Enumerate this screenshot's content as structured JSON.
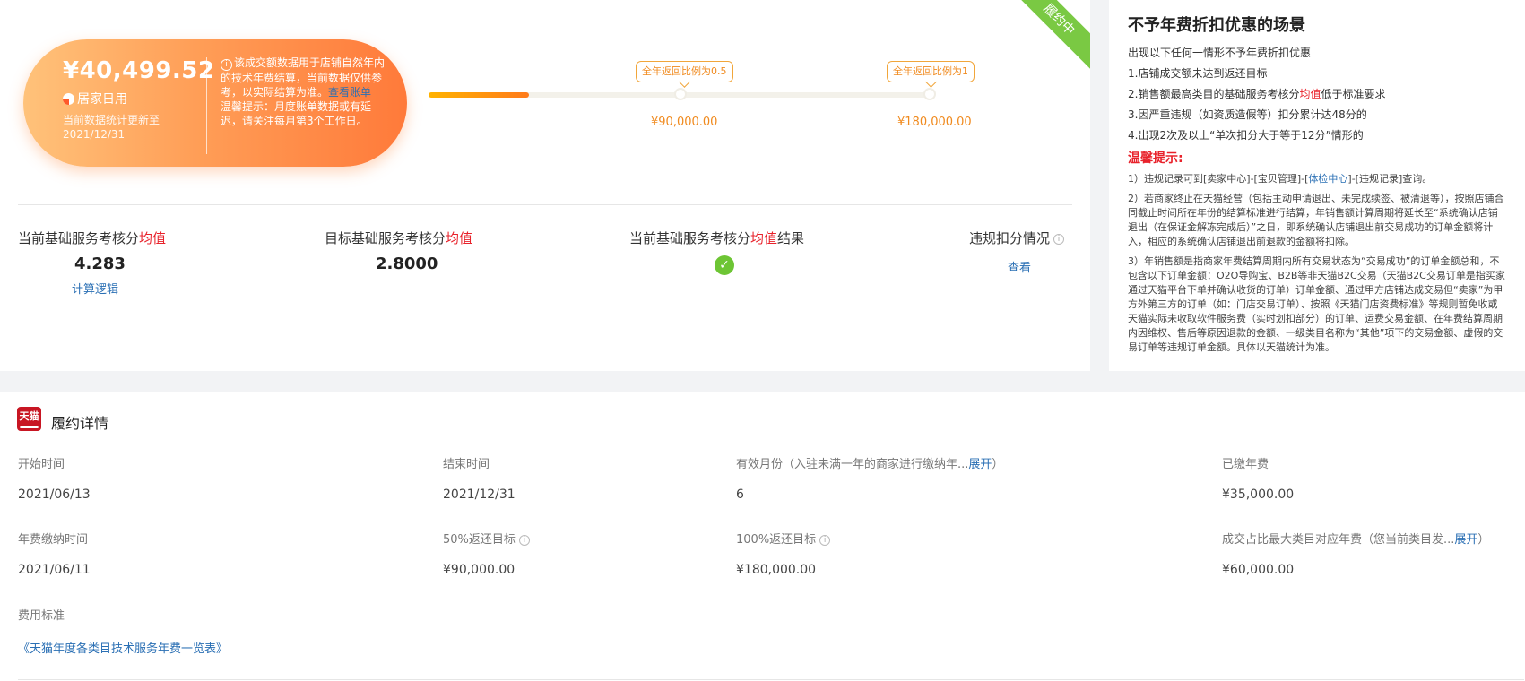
{
  "top": {
    "ribbon": "履约中",
    "amount": "¥40,499.52",
    "store_name": "居家日用",
    "update_note": "当前数据统计更新至2021/12/31",
    "desc_icon": "i",
    "desc_text": "该成交额数据用于店铺自然年内的技术年费结算，当前数据仅供参考，以实际结算为准。",
    "view_bill": "查看账单",
    "warm_tip": "温馨提示：月度账单数据或有延迟，请关注每月第3个工作日。",
    "progress_fraction": 0.2,
    "tag_half": "全年返回比例为0.5",
    "tag_full": "全年返回比例为1",
    "target_half": "¥90,000.00",
    "target_full": "¥180,000.00"
  },
  "metrics": {
    "current_title_prefix": "当前基础服务考核分",
    "avg": "均值",
    "current_value": "4.283",
    "calc_logic": "计算逻辑",
    "target_title_prefix": "目标基础服务考核分",
    "target_value": "2.8000",
    "result_title_prefix": "当前基础服务考核分",
    "result_suffix": "结果",
    "result_check": "✓",
    "penalty_title": "违规扣分情况",
    "penalty_link": "查看"
  },
  "rules": {
    "title": "不予年费折扣优惠的场景",
    "intro": "出现以下任何一情形不予年费折扣优惠",
    "r1": "1.店铺成交额未达到返还目标",
    "r2_prefix": "2.销售额最高类目的基础服务考核分",
    "r2_red": "均值",
    "r2_suffix": "低于标准要求",
    "r3": "3.因严重违规（如资质造假等）扣分累计达48分的",
    "r4": "4.出现2次及以上“单次扣分大于等于12分”情形的",
    "tips_title": "温馨提示:",
    "tip1_a": "1）违规记录可到[卖家中心]-[宝贝管理]-[",
    "tip1_link": "体检中心",
    "tip1_b": "]-[违规记录]查询。",
    "tip2": "2）若商家终止在天猫经营（包括主动申请退出、未完成续签、被清退等），按照店铺合同截止时间所在年份的结算标准进行结算，年销售额计算周期将延长至“系统确认店铺退出（在保证金解冻完成后）”之日，即系统确认店铺退出前交易成功的订单金额将计入，相应的系统确认店铺退出前退款的金额将扣除。",
    "tip3": "3）年销售额是指商家年费结算周期内所有交易状态为“交易成功”的订单金额总和，不包含以下订单金额：O2O导购宝、B2B等非天猫B2C交易（天猫B2C交易订单是指买家通过天猫平台下单并确认收货的订单）订单金额、通过甲方店铺达成交易但“卖家”为甲方外第三方的订单（如：门店交易订单）、按照《天猫门店资费标准》等规则暂免收或天猫实际未收取软件服务费（实时划扣部分）的订单、运费交易金额、在年费结算周期内因维权、售后等原因退款的金额、一级类目名称为“其他”项下的交易金额、虚假的交易订单等违规订单金额。具体以天猫统计为准。"
  },
  "details": {
    "logo": "天猫",
    "title": "履约详情",
    "start_label": "开始时间",
    "start_value": "2021/06/13",
    "end_label": "结束时间",
    "end_value": "2021/12/31",
    "months_label": "有效月份（入驻未满一年的商家进行缴纳年...",
    "expand": "展开",
    "months_close": "）",
    "months_value": "6",
    "paid_label": "已缴年费",
    "paid_value": "¥35,000.00",
    "pay_time_label": "年费缴纳时间",
    "pay_time_value": "2021/06/11",
    "half_target_label": "50%返还目标",
    "half_target_value": "¥90,000.00",
    "full_target_label": "100%返还目标",
    "full_target_value": "¥180,000.00",
    "max_cat_label": "成交占比最大类目对应年费（您当前类目发...",
    "max_cat_value": "¥60,000.00",
    "fee_std_label": "费用标准",
    "fee_std_link": "《天猫年度各类目技术服务年费一览表》"
  }
}
